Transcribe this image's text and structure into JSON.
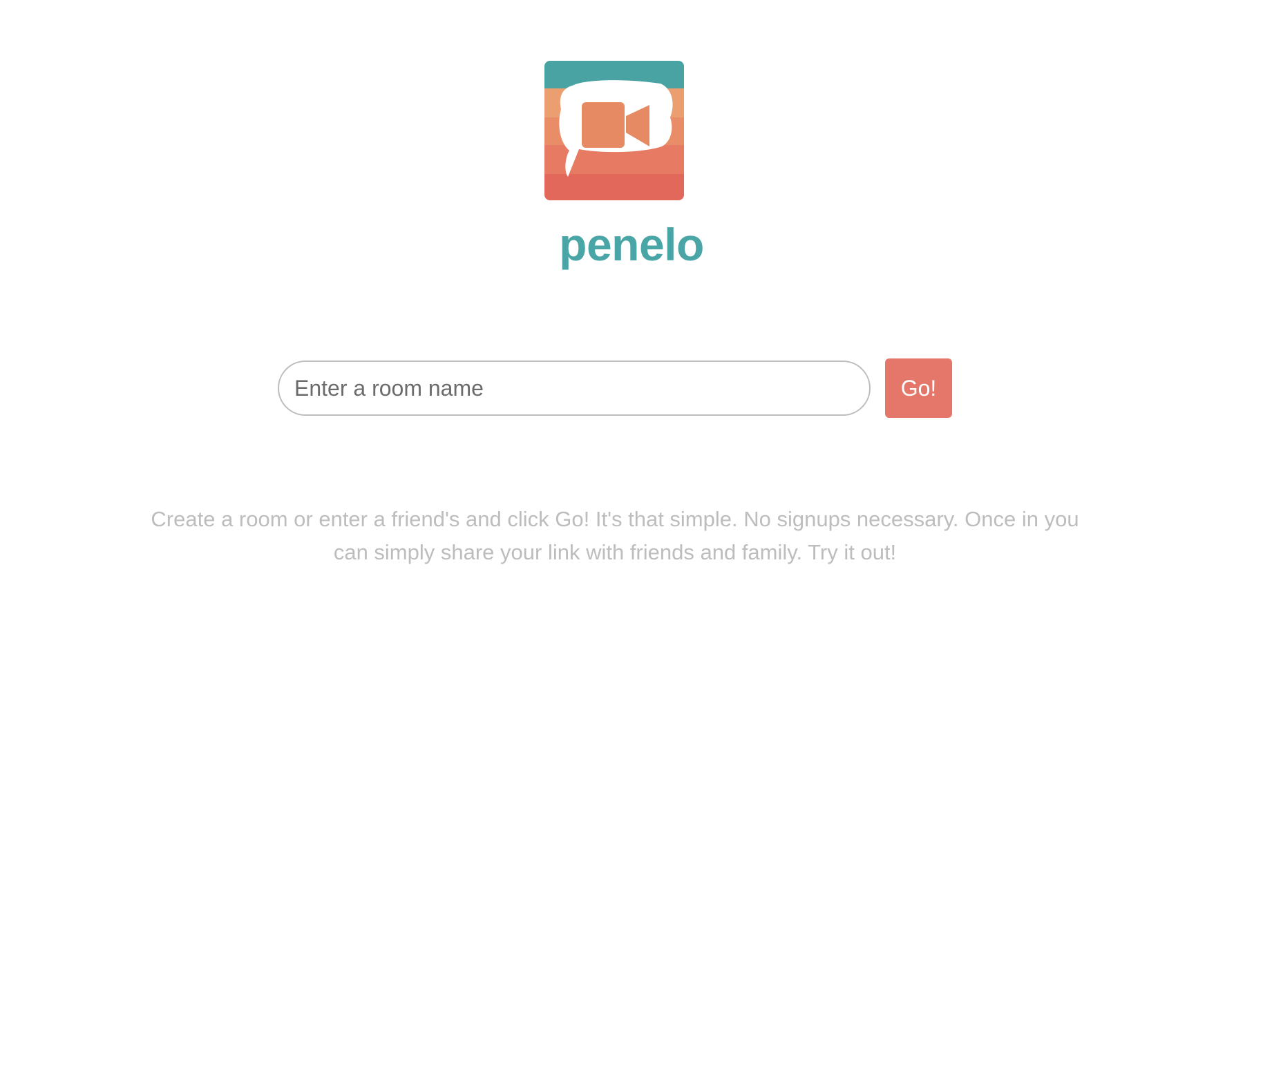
{
  "app": {
    "brand_name": "penelo",
    "brand_color": "#4aa5a6",
    "accent_color": "#e5776a",
    "logo_icon": "video-chat-bubble-icon"
  },
  "room_form": {
    "input_value": "",
    "input_placeholder": "Enter a room name",
    "go_label": "Go!"
  },
  "description": {
    "text": "Create a room or enter a friend's and click Go! It's that simple. No signups necessary. Once in you can simply share your link with friends and family. Try it out!"
  }
}
